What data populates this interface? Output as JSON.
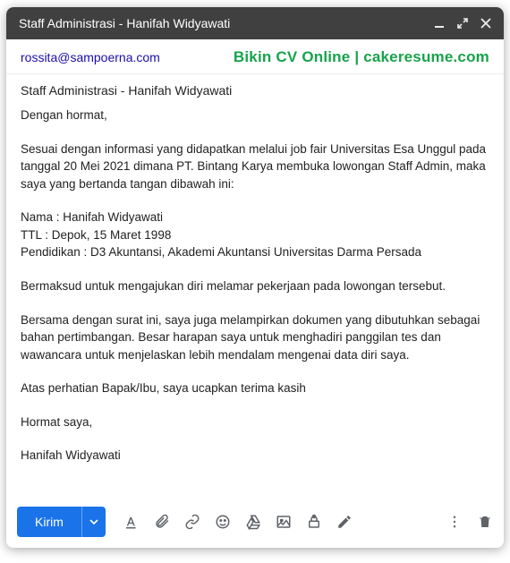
{
  "window": {
    "title": "Staff Administrasi - Hanifah Widyawati"
  },
  "header": {
    "recipient": "rossita@sampoerna.com",
    "watermark": "Bikin CV Online | cakeresume.com"
  },
  "subject": "Staff Administrasi - Hanifah Widyawati",
  "body": {
    "greeting": "Dengan hormat,",
    "p1": "Sesuai dengan informasi yang didapatkan melalui job fair Universitas Esa Unggul pada tanggal 20 Mei 2021 dimana PT. Bintang Karya membuka lowongan Staff Admin, maka saya yang bertanda tangan dibawah ini:",
    "line_nama": "Nama : Hanifah Widyawati",
    "line_ttl": "TTL : Depok, 15 Maret 1998",
    "line_pendidikan": "Pendidikan : D3 Akuntansi, Akademi Akuntansi Universitas Darma Persada",
    "p2": "Bermaksud untuk mengajukan diri melamar pekerjaan pada lowongan tersebut.",
    "p3": "Bersama dengan surat ini, saya juga melampirkan dokumen yang dibutuhkan sebagai bahan pertimbangan. Besar harapan saya untuk menghadiri panggilan tes dan wawancara untuk menjelaskan lebih mendalam mengenai data diri saya.",
    "p4": "Atas perhatian Bapak/Ibu, saya ucapkan terima kasih",
    "closing": "Hormat saya,",
    "signature": "Hanifah Widyawati"
  },
  "toolbar": {
    "send_label": "Kirim"
  },
  "icons": {
    "minimize": "minimize",
    "expand": "expand",
    "close": "close",
    "font": "font",
    "attach": "attach",
    "link": "link",
    "emoji": "emoji",
    "drive": "drive",
    "image": "image",
    "confidential": "confidential",
    "pen": "pen",
    "more": "more",
    "trash": "trash"
  }
}
